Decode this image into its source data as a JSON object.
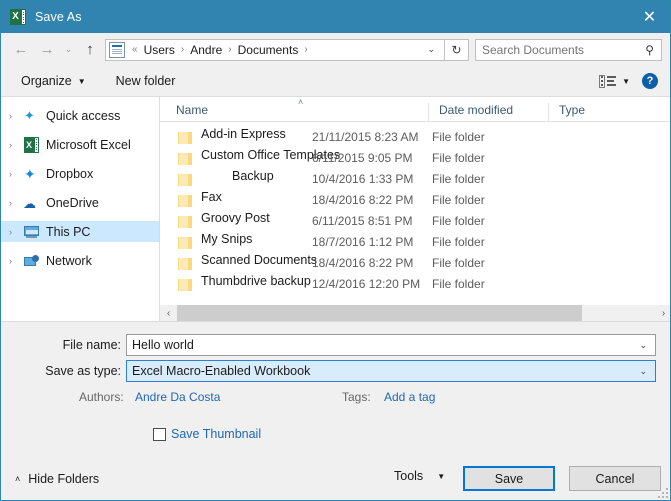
{
  "window": {
    "title": "Save As",
    "app_icon": "excel-icon",
    "close_label": "✕",
    "titlebar_color": "#3184b0"
  },
  "nav": {
    "back_label": "←",
    "forward_label": "→",
    "recent_label": "⌄",
    "up_label": "↑",
    "address_icon": "document-icon",
    "overflow_label": "«",
    "breadcrumbs": [
      "Users",
      "Andre",
      "Documents"
    ],
    "separator": "›",
    "dropdown_label": "⌄",
    "refresh_label": "↻"
  },
  "search": {
    "value": "",
    "placeholder": "Search Documents",
    "icon_label": "⚲"
  },
  "toolbar": {
    "organize_label": "Organize",
    "organize_caret": "▼",
    "new_folder_label": "New folder",
    "view_caret": "▼",
    "help_label": "?"
  },
  "sidebar": {
    "items": [
      {
        "label": "Quick access",
        "icon": "star-icon",
        "chevron": "›",
        "selected": false
      },
      {
        "label": "Microsoft Excel",
        "icon": "excel-icon",
        "chevron": "›",
        "selected": false
      },
      {
        "label": "Dropbox",
        "icon": "dropbox-icon",
        "chevron": "›",
        "selected": false
      },
      {
        "label": "OneDrive",
        "icon": "cloud-icon",
        "chevron": "›",
        "selected": false
      },
      {
        "label": "This PC",
        "icon": "computer-icon",
        "chevron": "›",
        "selected": true
      },
      {
        "label": "Network",
        "icon": "network-icon",
        "chevron": "›",
        "selected": false
      }
    ]
  },
  "filelist": {
    "columns": {
      "name": "Name",
      "date_modified": "Date modified",
      "type": "Type"
    },
    "sort_indicator": "˄",
    "rows": [
      {
        "name": "Add-in Express",
        "date": "21/11/2015 8:23 AM",
        "type": "File folder",
        "indent": false
      },
      {
        "name": "Custom Office Templates",
        "date": "6/11/2015 9:05 PM",
        "type": "File folder",
        "indent": false
      },
      {
        "name": "Backup",
        "date": "10/4/2016 1:33 PM",
        "type": "File folder",
        "indent": true
      },
      {
        "name": "Fax",
        "date": "18/4/2016 8:22 PM",
        "type": "File folder",
        "indent": false
      },
      {
        "name": "Groovy Post",
        "date": "6/11/2015 8:51 PM",
        "type": "File folder",
        "indent": false
      },
      {
        "name": "My Snips",
        "date": "18/7/2016 1:12 PM",
        "type": "File folder",
        "indent": false
      },
      {
        "name": "Scanned Documents",
        "date": "18/4/2016 8:22 PM",
        "type": "File folder",
        "indent": false
      },
      {
        "name": "Thumbdrive backup",
        "date": "12/4/2016 12:20 PM",
        "type": "File folder",
        "indent": false
      }
    ],
    "scroll_left_label": "‹",
    "scroll_right_label": "›"
  },
  "form": {
    "file_name_label": "File name:",
    "file_name_value": "Hello world",
    "file_name_caret": "⌄",
    "save_as_type_label": "Save as type:",
    "save_as_type_value": "Excel Macro-Enabled Workbook",
    "save_as_type_caret": "⌄",
    "authors_label": "Authors:",
    "authors_value": "Andre Da Costa",
    "tags_label": "Tags:",
    "tags_value": "Add a tag"
  },
  "footer": {
    "save_thumbnail_label": "Save Thumbnail",
    "save_thumbnail_checked": false,
    "hide_folders_label": "Hide Folders",
    "hide_folders_caret": "˄",
    "tools_label": "Tools",
    "tools_caret": "▼",
    "save_label": "Save",
    "cancel_label": "Cancel"
  },
  "colors": {
    "title_bar": "#3184b0",
    "accent_blue": "#0078d7",
    "link_blue": "#1f68b5",
    "selection_blue": "#cce8ff",
    "focus_field_blue": "#d9ecfb",
    "folder_yellow": "#fbd97f"
  }
}
